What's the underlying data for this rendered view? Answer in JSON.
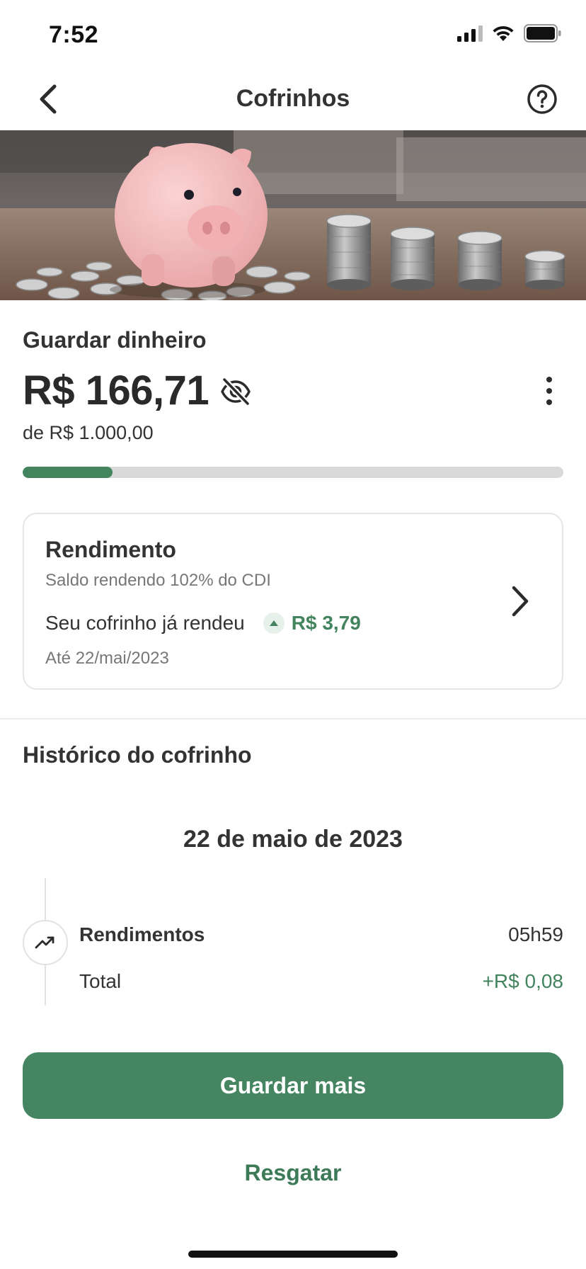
{
  "status_bar": {
    "time": "7:52"
  },
  "nav": {
    "title": "Cofrinhos",
    "back_icon": "chevron-left-icon",
    "help_icon": "question-circle-icon"
  },
  "banner": {
    "image": "piggy-bank-with-coin-stacks"
  },
  "goal": {
    "name": "Guardar dinheiro",
    "amount": "R$ 166,71",
    "target": "de R$ 1.000,00",
    "progress_fraction": 0.1667,
    "hide_icon": "eye-off-icon",
    "more_icon": "more-vertical-icon"
  },
  "yield_card": {
    "title": "Rendimento",
    "subtitle": "Saldo rendendo 102% do CDI",
    "earned_label": "Seu cofrinho já rendeu",
    "earned_value": "R$ 3,79",
    "until": "Até 22/mai/2023"
  },
  "history": {
    "title": "Histórico do cofrinho",
    "groups": [
      {
        "date": "22 de maio de 2023",
        "entries": [
          {
            "title": "Rendimentos",
            "time": "05h59",
            "label": "Total",
            "value": "+R$ 0,08",
            "icon": "trending-up-icon"
          }
        ]
      }
    ]
  },
  "actions": {
    "primary": "Guardar mais",
    "secondary": "Resgatar"
  },
  "colors": {
    "accent": "#458562",
    "accent_text": "#43845f",
    "track": "#d9d9d9"
  }
}
